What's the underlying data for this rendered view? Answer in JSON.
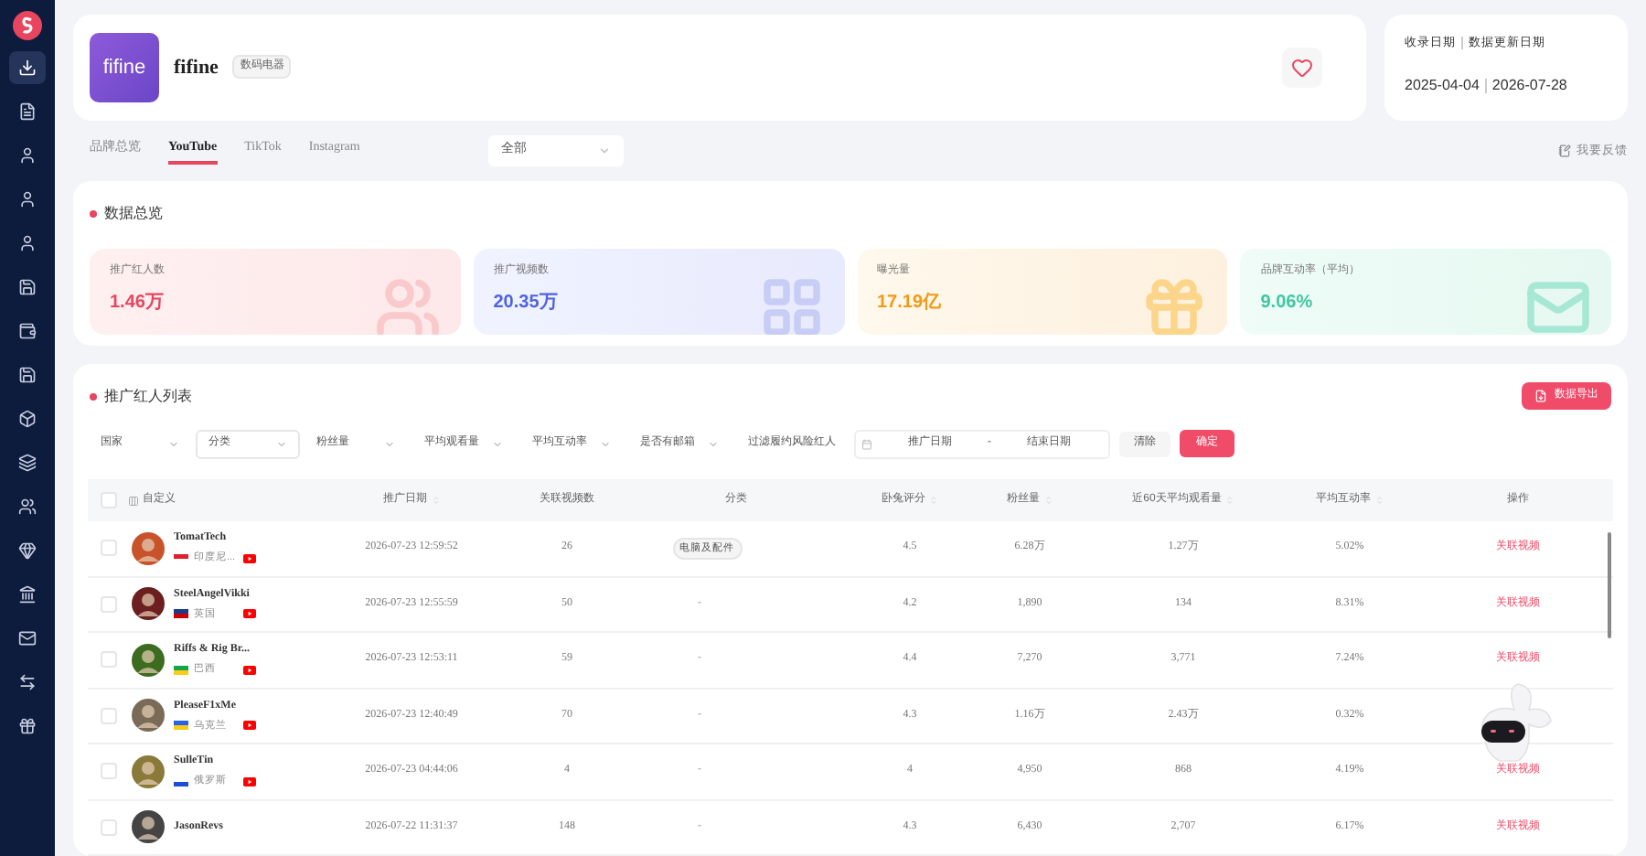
{
  "sidebar": {
    "items": [
      {
        "selected": true
      },
      {
        "selected": false
      },
      {
        "selected": false
      },
      {
        "selected": false
      },
      {
        "selected": false
      },
      {
        "selected": false
      },
      {
        "selected": false
      },
      {
        "selected": false
      },
      {
        "selected": false
      },
      {
        "selected": false
      },
      {
        "selected": false
      },
      {
        "selected": false
      },
      {
        "selected": false
      },
      {
        "selected": false
      },
      {
        "selected": false
      },
      {
        "selected": false
      }
    ]
  },
  "brand": {
    "logo_text": "fifine",
    "name": "fifine",
    "tag": "数码电器",
    "favorited": false
  },
  "dates": {
    "labels": [
      "收录日期",
      "数据更新日期"
    ],
    "values": [
      "2025-04-04",
      "2026-07-28"
    ]
  },
  "tabs": [
    {
      "label": "品牌总览",
      "selected": false
    },
    {
      "label": "YouTube",
      "selected": true
    },
    {
      "label": "TikTok",
      "selected": false
    },
    {
      "label": "Instagram",
      "selected": false
    }
  ],
  "scope_select": {
    "value": "全部"
  },
  "feedback": "我要反馈",
  "overview": {
    "title": "数据总览",
    "cards": [
      {
        "kind": "people",
        "label": "推广红人数",
        "value": "1.46万"
      },
      {
        "kind": "video",
        "label": "推广视频数",
        "value": "20.35万"
      },
      {
        "kind": "exposure",
        "label": "曝光量",
        "value": "17.19亿"
      },
      {
        "kind": "engagement",
        "label": "品牌互动率（平均）",
        "value": "9.06%"
      }
    ]
  },
  "list": {
    "title": "推广红人列表",
    "export_button": "数据导出",
    "filters": [
      {
        "label": "国家",
        "bordered": false
      },
      {
        "label": "分类",
        "bordered": true
      },
      {
        "label": "粉丝量",
        "bordered": false
      },
      {
        "label": "平均观看量",
        "bordered": false
      },
      {
        "label": "平均互动率",
        "bordered": false
      },
      {
        "label": "是否有邮箱",
        "bordered": false
      },
      {
        "label": "过滤履约风险红人",
        "bordered": false
      }
    ],
    "date_range": {
      "start_placeholder": "推广日期",
      "separator": "-",
      "end_placeholder": "结束日期"
    },
    "clear_button": "清除",
    "confirm_button": "确定",
    "select_all_checked": false,
    "columns": [
      {
        "label": "自定义",
        "sortable": false
      },
      {
        "label": "推广日期",
        "sortable": true
      },
      {
        "label": "关联视频数",
        "sortable": false
      },
      {
        "label": "分类",
        "sortable": false
      },
      {
        "label": "卧兔评分",
        "sortable": true
      },
      {
        "label": "粉丝量",
        "sortable": true
      },
      {
        "label": "近60天平均观看量",
        "sortable": true
      },
      {
        "label": "平均互动率",
        "sortable": true
      },
      {
        "label": "操作",
        "sortable": false
      }
    ],
    "rows": [
      {
        "checked": false,
        "name": "TomatTech",
        "country": "印度尼...",
        "date": "2026-07-23 12:59:52",
        "videos": "26",
        "category": "电脑及配件",
        "rating": "4.5",
        "fans": "6.28万",
        "views": "1.27万",
        "rate": "5.02%",
        "action": "关联视频"
      },
      {
        "checked": false,
        "name": "SteelAngelVikki",
        "country": "英国",
        "date": "2026-07-23 12:55:59",
        "videos": "50",
        "category": "-",
        "rating": "4.2",
        "fans": "1,890",
        "views": "134",
        "rate": "8.31%",
        "action": "关联视频"
      },
      {
        "checked": false,
        "name": "Riffs & Rig Br...",
        "country": "巴西",
        "date": "2026-07-23 12:53:11",
        "videos": "59",
        "category": "-",
        "rating": "4.4",
        "fans": "7,270",
        "views": "3,771",
        "rate": "7.24%",
        "action": "关联视频"
      },
      {
        "checked": false,
        "name": "PleaseF1xMe",
        "country": "乌克兰",
        "date": "2026-07-23 12:40:49",
        "videos": "70",
        "category": "-",
        "rating": "4.3",
        "fans": "1.16万",
        "views": "2.43万",
        "rate": "0.32%"
      },
      {
        "checked": false,
        "name": "SulleTin",
        "country": "俄罗斯",
        "date": "2026-07-23 04:44:06",
        "videos": "4",
        "category": "-",
        "rating": "4",
        "fans": "4,950",
        "views": "868",
        "rate": "4.19%",
        "action": "关联视频"
      },
      {
        "checked": false,
        "name": "JasonRevs",
        "date": "2026-07-22 11:31:37",
        "videos": "148",
        "category": "-",
        "rating": "4.3",
        "fans": "6,430",
        "views": "2,707",
        "rate": "6.17%",
        "action": "关联视频"
      }
    ]
  }
}
